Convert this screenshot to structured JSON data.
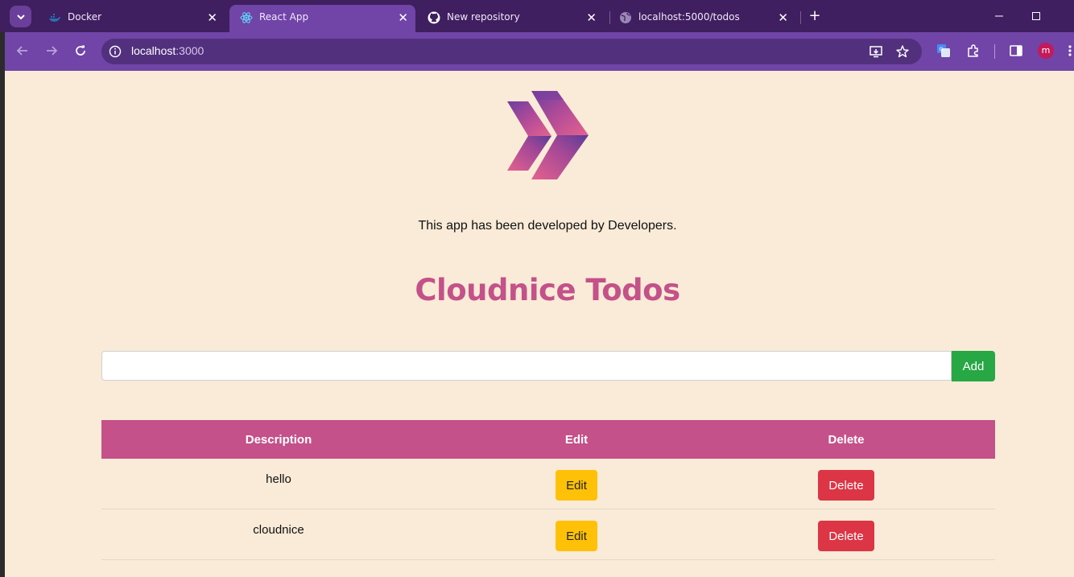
{
  "browser": {
    "tabs": [
      {
        "title": "Docker",
        "icon": "docker-icon",
        "active": false
      },
      {
        "title": "React App",
        "icon": "react-icon",
        "active": true
      },
      {
        "title": "New repository",
        "icon": "github-icon",
        "active": false
      },
      {
        "title": "localhost:5000/todos",
        "icon": "globe-icon",
        "active": false
      }
    ],
    "close_glyph": "✕",
    "new_tab_glyph": "+",
    "url_host": "localhost",
    "url_port": ":3000",
    "profile_initial": "m"
  },
  "page": {
    "credit": "This app has been developed by Developers.",
    "title": "Cloudnice Todos",
    "input": {
      "value": "",
      "placeholder": ""
    },
    "add_label": "Add",
    "table": {
      "headers": {
        "description": "Description",
        "edit": "Edit",
        "delete": "Delete"
      },
      "rows": [
        {
          "description": "hello",
          "edit": "Edit",
          "delete": "Delete"
        },
        {
          "description": "cloudnice",
          "edit": "Edit",
          "delete": "Delete"
        }
      ]
    }
  },
  "colors": {
    "page_bg": "#f9ebd7",
    "accent": "#c45189",
    "add": "#28a745",
    "edit": "#ffc107",
    "delete": "#dc3545",
    "browser_frame": "#3f1f5f",
    "browser_toolbar": "#7144a7"
  }
}
